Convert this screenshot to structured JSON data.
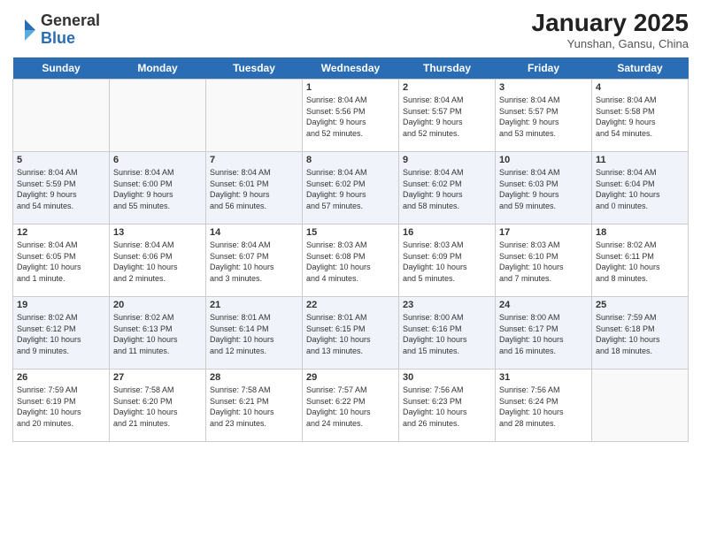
{
  "logo": {
    "general": "General",
    "blue": "Blue"
  },
  "header": {
    "month": "January 2025",
    "location": "Yunshan, Gansu, China"
  },
  "days_of_week": [
    "Sunday",
    "Monday",
    "Tuesday",
    "Wednesday",
    "Thursday",
    "Friday",
    "Saturday"
  ],
  "weeks": [
    [
      {
        "day": "",
        "info": ""
      },
      {
        "day": "",
        "info": ""
      },
      {
        "day": "",
        "info": ""
      },
      {
        "day": "1",
        "info": "Sunrise: 8:04 AM\nSunset: 5:56 PM\nDaylight: 9 hours\nand 52 minutes."
      },
      {
        "day": "2",
        "info": "Sunrise: 8:04 AM\nSunset: 5:57 PM\nDaylight: 9 hours\nand 52 minutes."
      },
      {
        "day": "3",
        "info": "Sunrise: 8:04 AM\nSunset: 5:57 PM\nDaylight: 9 hours\nand 53 minutes."
      },
      {
        "day": "4",
        "info": "Sunrise: 8:04 AM\nSunset: 5:58 PM\nDaylight: 9 hours\nand 54 minutes."
      }
    ],
    [
      {
        "day": "5",
        "info": "Sunrise: 8:04 AM\nSunset: 5:59 PM\nDaylight: 9 hours\nand 54 minutes."
      },
      {
        "day": "6",
        "info": "Sunrise: 8:04 AM\nSunset: 6:00 PM\nDaylight: 9 hours\nand 55 minutes."
      },
      {
        "day": "7",
        "info": "Sunrise: 8:04 AM\nSunset: 6:01 PM\nDaylight: 9 hours\nand 56 minutes."
      },
      {
        "day": "8",
        "info": "Sunrise: 8:04 AM\nSunset: 6:02 PM\nDaylight: 9 hours\nand 57 minutes."
      },
      {
        "day": "9",
        "info": "Sunrise: 8:04 AM\nSunset: 6:02 PM\nDaylight: 9 hours\nand 58 minutes."
      },
      {
        "day": "10",
        "info": "Sunrise: 8:04 AM\nSunset: 6:03 PM\nDaylight: 9 hours\nand 59 minutes."
      },
      {
        "day": "11",
        "info": "Sunrise: 8:04 AM\nSunset: 6:04 PM\nDaylight: 10 hours\nand 0 minutes."
      }
    ],
    [
      {
        "day": "12",
        "info": "Sunrise: 8:04 AM\nSunset: 6:05 PM\nDaylight: 10 hours\nand 1 minute."
      },
      {
        "day": "13",
        "info": "Sunrise: 8:04 AM\nSunset: 6:06 PM\nDaylight: 10 hours\nand 2 minutes."
      },
      {
        "day": "14",
        "info": "Sunrise: 8:04 AM\nSunset: 6:07 PM\nDaylight: 10 hours\nand 3 minutes."
      },
      {
        "day": "15",
        "info": "Sunrise: 8:03 AM\nSunset: 6:08 PM\nDaylight: 10 hours\nand 4 minutes."
      },
      {
        "day": "16",
        "info": "Sunrise: 8:03 AM\nSunset: 6:09 PM\nDaylight: 10 hours\nand 5 minutes."
      },
      {
        "day": "17",
        "info": "Sunrise: 8:03 AM\nSunset: 6:10 PM\nDaylight: 10 hours\nand 7 minutes."
      },
      {
        "day": "18",
        "info": "Sunrise: 8:02 AM\nSunset: 6:11 PM\nDaylight: 10 hours\nand 8 minutes."
      }
    ],
    [
      {
        "day": "19",
        "info": "Sunrise: 8:02 AM\nSunset: 6:12 PM\nDaylight: 10 hours\nand 9 minutes."
      },
      {
        "day": "20",
        "info": "Sunrise: 8:02 AM\nSunset: 6:13 PM\nDaylight: 10 hours\nand 11 minutes."
      },
      {
        "day": "21",
        "info": "Sunrise: 8:01 AM\nSunset: 6:14 PM\nDaylight: 10 hours\nand 12 minutes."
      },
      {
        "day": "22",
        "info": "Sunrise: 8:01 AM\nSunset: 6:15 PM\nDaylight: 10 hours\nand 13 minutes."
      },
      {
        "day": "23",
        "info": "Sunrise: 8:00 AM\nSunset: 6:16 PM\nDaylight: 10 hours\nand 15 minutes."
      },
      {
        "day": "24",
        "info": "Sunrise: 8:00 AM\nSunset: 6:17 PM\nDaylight: 10 hours\nand 16 minutes."
      },
      {
        "day": "25",
        "info": "Sunrise: 7:59 AM\nSunset: 6:18 PM\nDaylight: 10 hours\nand 18 minutes."
      }
    ],
    [
      {
        "day": "26",
        "info": "Sunrise: 7:59 AM\nSunset: 6:19 PM\nDaylight: 10 hours\nand 20 minutes."
      },
      {
        "day": "27",
        "info": "Sunrise: 7:58 AM\nSunset: 6:20 PM\nDaylight: 10 hours\nand 21 minutes."
      },
      {
        "day": "28",
        "info": "Sunrise: 7:58 AM\nSunset: 6:21 PM\nDaylight: 10 hours\nand 23 minutes."
      },
      {
        "day": "29",
        "info": "Sunrise: 7:57 AM\nSunset: 6:22 PM\nDaylight: 10 hours\nand 24 minutes."
      },
      {
        "day": "30",
        "info": "Sunrise: 7:56 AM\nSunset: 6:23 PM\nDaylight: 10 hours\nand 26 minutes."
      },
      {
        "day": "31",
        "info": "Sunrise: 7:56 AM\nSunset: 6:24 PM\nDaylight: 10 hours\nand 28 minutes."
      },
      {
        "day": "",
        "info": ""
      }
    ]
  ]
}
